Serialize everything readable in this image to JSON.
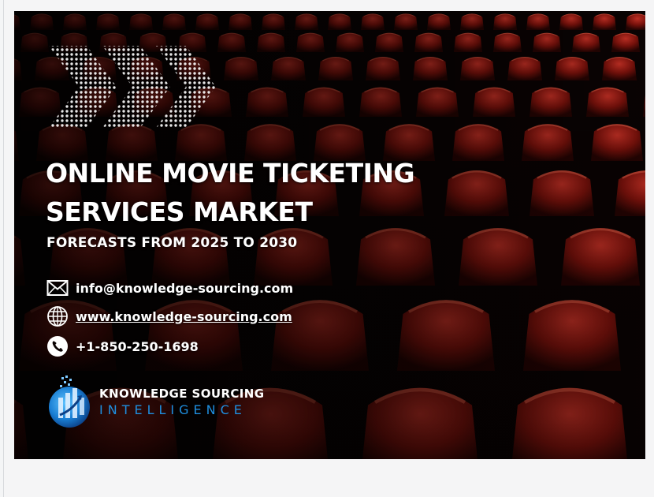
{
  "cover": {
    "title_line1": "ONLINE MOVIE TICKETING",
    "title_line2": "SERVICES MARKET",
    "subtitle": "FORECASTS FROM 2025 TO 2030"
  },
  "contacts": {
    "email": "info@knowledge-sourcing.com",
    "website": "www.knowledge-sourcing.com",
    "phone": "+1-850-250-1698"
  },
  "logo": {
    "line1": "KNOWLEDGE SOURCING",
    "line2": "INTELLIGENCE"
  },
  "icons": {
    "email": "envelope-icon",
    "website": "globe-icon",
    "phone": "phone-icon",
    "decor": "chevron-arrows-icon"
  },
  "colors": {
    "seat": "#b01a12",
    "background": "#0b0303",
    "logo_blue": "#1f8fe0"
  }
}
